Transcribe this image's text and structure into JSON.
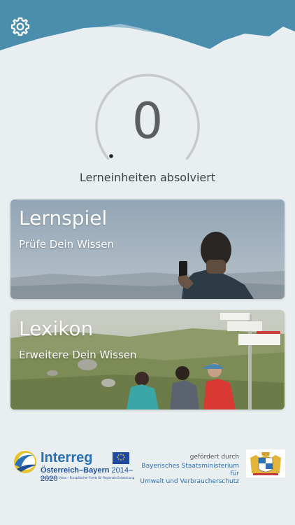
{
  "header": {
    "settings_icon": "gear-icon"
  },
  "progress": {
    "value": "0",
    "caption": "Lerneinheiten absolviert",
    "fraction": 0
  },
  "cards": [
    {
      "title": "Lernspiel",
      "subtitle": "Prüfe Dein Wissen"
    },
    {
      "title": "Lexikon",
      "subtitle": "Erweitere Dein Wissen"
    }
  ],
  "footer": {
    "interreg_word": "Interreg",
    "interreg_region": "Österreich–Bayern",
    "interreg_years": "2014–2020",
    "interreg_fine": "Europäische Union – Europäischer Fonds für Regionale Entwicklung",
    "funded_by": "gefördert durch",
    "ministry_line1": "Bayerisches Staatsministerium für",
    "ministry_line2": "Umwelt und Verbraucherschutz"
  },
  "colors": {
    "header": "#4a8dad",
    "accent_blue": "#2a6fb5"
  }
}
